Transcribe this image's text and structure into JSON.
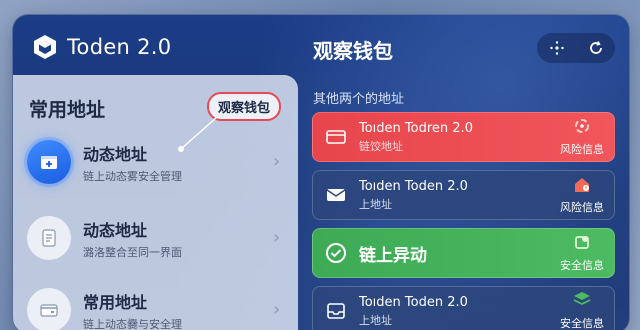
{
  "app": {
    "brand_name": "Toden 2.0"
  },
  "header": {
    "title": "观察钱包",
    "actions": [
      "connect-icon",
      "refresh-icon"
    ]
  },
  "left": {
    "title": "常用地址",
    "callout": "观察钱包",
    "items": [
      {
        "name": "动态地址",
        "sub": "链上动态雾安全管理",
        "icon": "wallet-add-icon"
      },
      {
        "name": "动态地址",
        "sub": "潞洛整合至同一界面",
        "icon": "document-icon"
      },
      {
        "name": "常用地址",
        "sub": "链上动态爨与安全理",
        "icon": "card-icon"
      }
    ]
  },
  "right": {
    "subtitle": "其他两个的地址",
    "cards": [
      {
        "title": "Toıden Todren 2.0",
        "sub": "链饺地址",
        "status": "风险信息",
        "style": "red"
      },
      {
        "title": "Toıden Toden 2.0",
        "sub": "上地址",
        "status": "风险信息",
        "style": "neutral"
      },
      {
        "title": "链上异动",
        "sub": "",
        "status": "安全信息",
        "style": "green"
      },
      {
        "title": "Toıden Toden 2.0",
        "sub": "上地址",
        "status": "安全信息",
        "style": "neutral"
      }
    ]
  },
  "colors": {
    "accent": "#1a5de0",
    "danger": "#e8454c",
    "success": "#3daa55",
    "callout_border": "#e64a55"
  }
}
